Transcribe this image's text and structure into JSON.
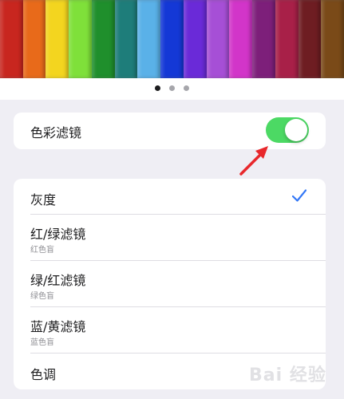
{
  "hero": {
    "pencil_colors": [
      "#c8261f",
      "#e86a1a",
      "#f3d51f",
      "#7fe03a",
      "#1f8f2c",
      "#1e7d7a",
      "#5ab1e8",
      "#1438d6",
      "#6a2ad8",
      "#a64fd6",
      "#d235c9",
      "#7d1f7a",
      "#a82048",
      "#6e1d22",
      "#7a4a18"
    ],
    "page_dots": [
      "active",
      "inactive",
      "inactive"
    ]
  },
  "color_filter": {
    "label": "色彩滤镜",
    "enabled": true,
    "switch_color": "#4cd964"
  },
  "filters": [
    {
      "title": "灰度",
      "subtitle": "",
      "selected": true
    },
    {
      "title": "红/绿滤镜",
      "subtitle": "红色盲",
      "selected": false
    },
    {
      "title": "绿/红滤镜",
      "subtitle": "绿色盲",
      "selected": false
    },
    {
      "title": "蓝/黄滤镜",
      "subtitle": "蓝色盲",
      "selected": false
    },
    {
      "title": "色调",
      "subtitle": "",
      "selected": false
    }
  ],
  "watermark": "Bai 经验",
  "accent_color": "#3478f6",
  "annotation_arrow_color": "#e8272b"
}
